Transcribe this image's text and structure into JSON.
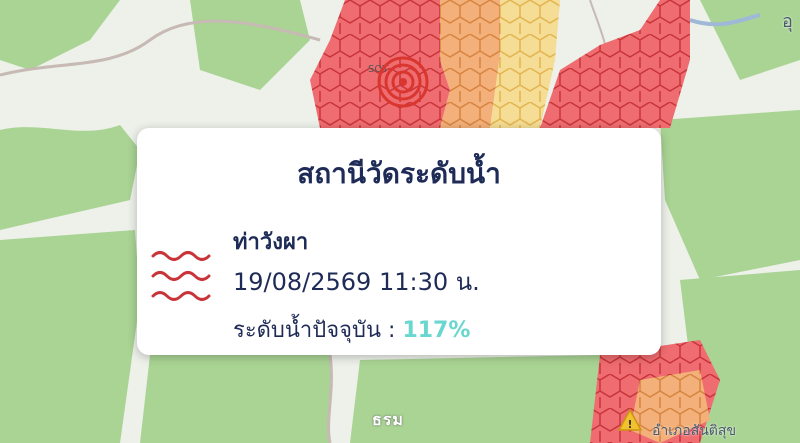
{
  "popup": {
    "title": "สถานีวัดระดับน้ำ",
    "station_name": "ท่าวังผา",
    "datetime": "19/08/2569 11:30 น.",
    "level_label": "ระดับน้ำปัจจุบัน :",
    "level_value": "117%",
    "icon": "water-waves-icon"
  },
  "map": {
    "labels": {
      "town_top": "อุ",
      "place_bottom": "อำเภอสันติสุข"
    },
    "marker": "radar-target-icon",
    "warning": "warning-triangle-icon"
  },
  "watermark": "ธรม",
  "colors": {
    "title": "#1f2b57",
    "level_value": "#69d7cf",
    "hex_red": "#e8525a",
    "hex_orange": "#f3a96a",
    "hex_yellow": "#f2d27a",
    "forest": "#a6d390",
    "waves": "#c9343a"
  }
}
